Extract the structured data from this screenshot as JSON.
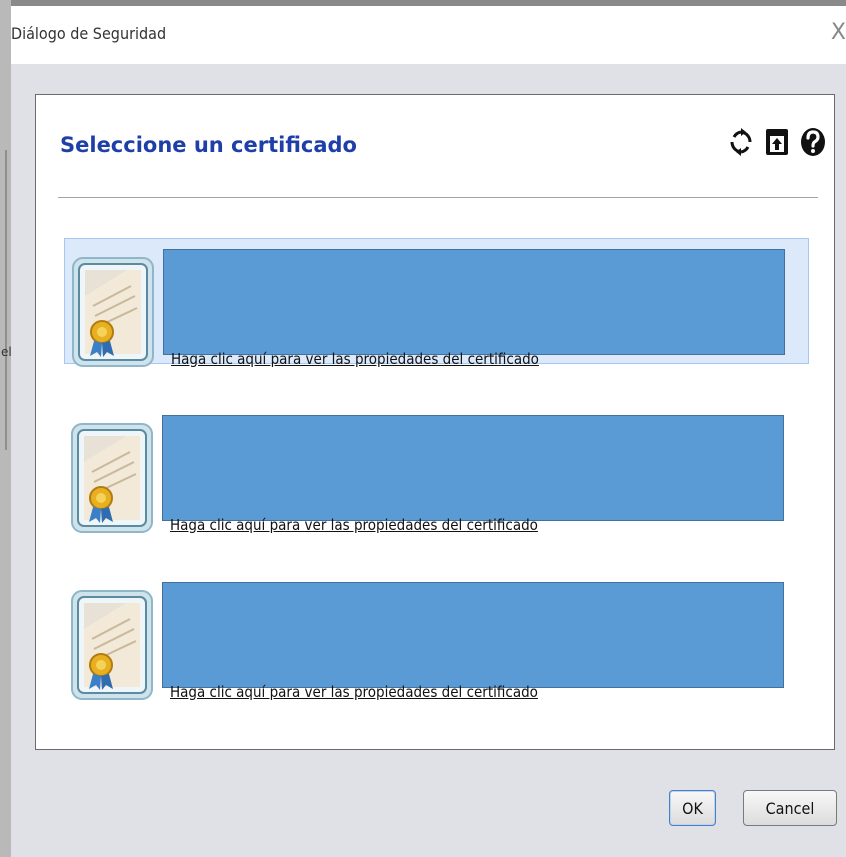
{
  "dialog": {
    "title": "Diálogo de Seguridad",
    "close_glyph": "X",
    "partial_left_text": "el"
  },
  "panel": {
    "heading": "Seleccione un certificado",
    "toolbar": [
      {
        "icon": "refresh-icon"
      },
      {
        "icon": "import-icon"
      },
      {
        "icon": "help-icon"
      }
    ]
  },
  "certificates": [
    {
      "link_text": "Haga clic aquí para ver las propiedades del certificado",
      "selected": true
    },
    {
      "link_text": "Haga clic aquí para ver las propiedades del certificado",
      "selected": false
    },
    {
      "link_text": "Haga clic aquí para ver las propiedades del certificado",
      "selected": false
    }
  ],
  "buttons": {
    "ok": "OK",
    "cancel": "Cancel"
  },
  "colors": {
    "heading": "#1f3fa8",
    "redaction_box": "#5b9bd5",
    "selection": "#dbe9fb"
  }
}
